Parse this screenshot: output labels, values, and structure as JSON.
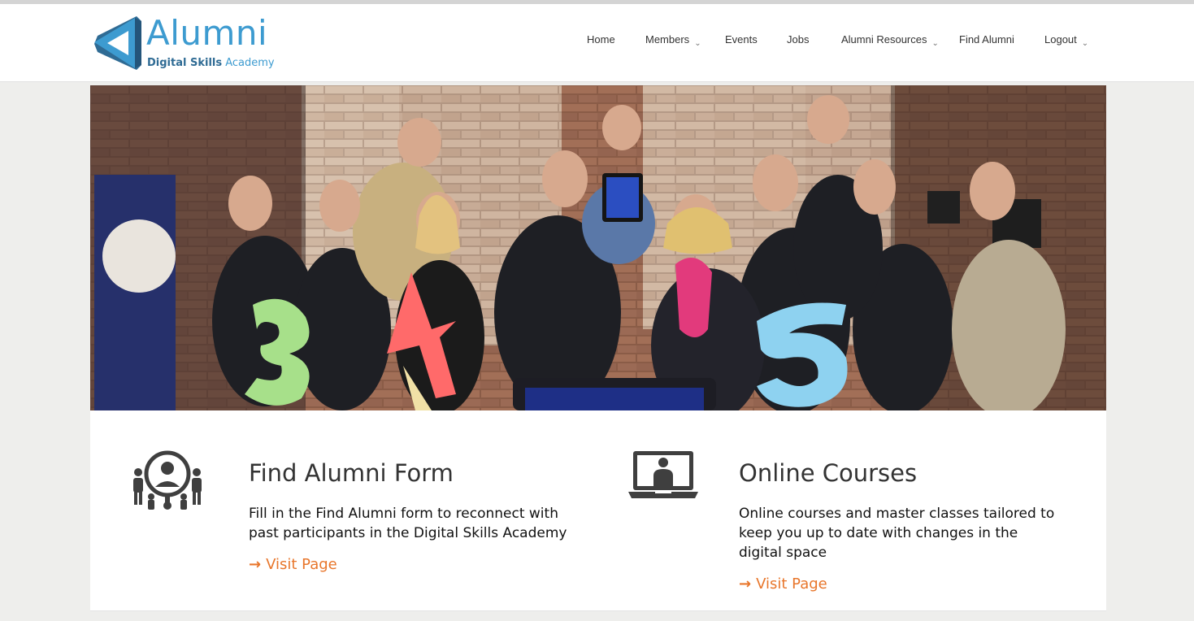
{
  "header": {
    "logo": {
      "brand": "Alumni",
      "tagline_bold": "Digital Skills",
      "tagline_light": "Academy"
    },
    "nav": [
      {
        "label": "Home",
        "icon": null
      },
      {
        "label": "Members",
        "icon": "chevron-down-icon"
      },
      {
        "label": "Events",
        "icon": null
      },
      {
        "label": "Jobs",
        "icon": null
      },
      {
        "label": "Alumni Resources",
        "icon": "chevron-down-icon"
      },
      {
        "label": "Find Alumni",
        "icon": null
      },
      {
        "label": "Logout",
        "icon": "chevron-down-icon"
      }
    ]
  },
  "hero": {
    "description": "Group photo of alumni with cartoon number mascots"
  },
  "features": [
    {
      "icon": "people-network-icon",
      "title": "Find Alumni Form",
      "description": "Fill in the Find Alumni form to reconnect with past participants in the Digital Skills Academy",
      "link_label": "Visit Page",
      "link_icon": "arrow-right-icon"
    },
    {
      "icon": "laptop-user-icon",
      "title": "Online Courses",
      "description": "Online courses and master classes tailored to keep you up to date with changes in the digital space",
      "link_label": "Visit Page",
      "link_icon": "arrow-right-icon"
    }
  ],
  "colors": {
    "brand_blue": "#3d9bd0",
    "brand_dark_blue": "#2f6b94",
    "link_orange": "#e8762b",
    "icon_gray": "#3f3f3f"
  }
}
